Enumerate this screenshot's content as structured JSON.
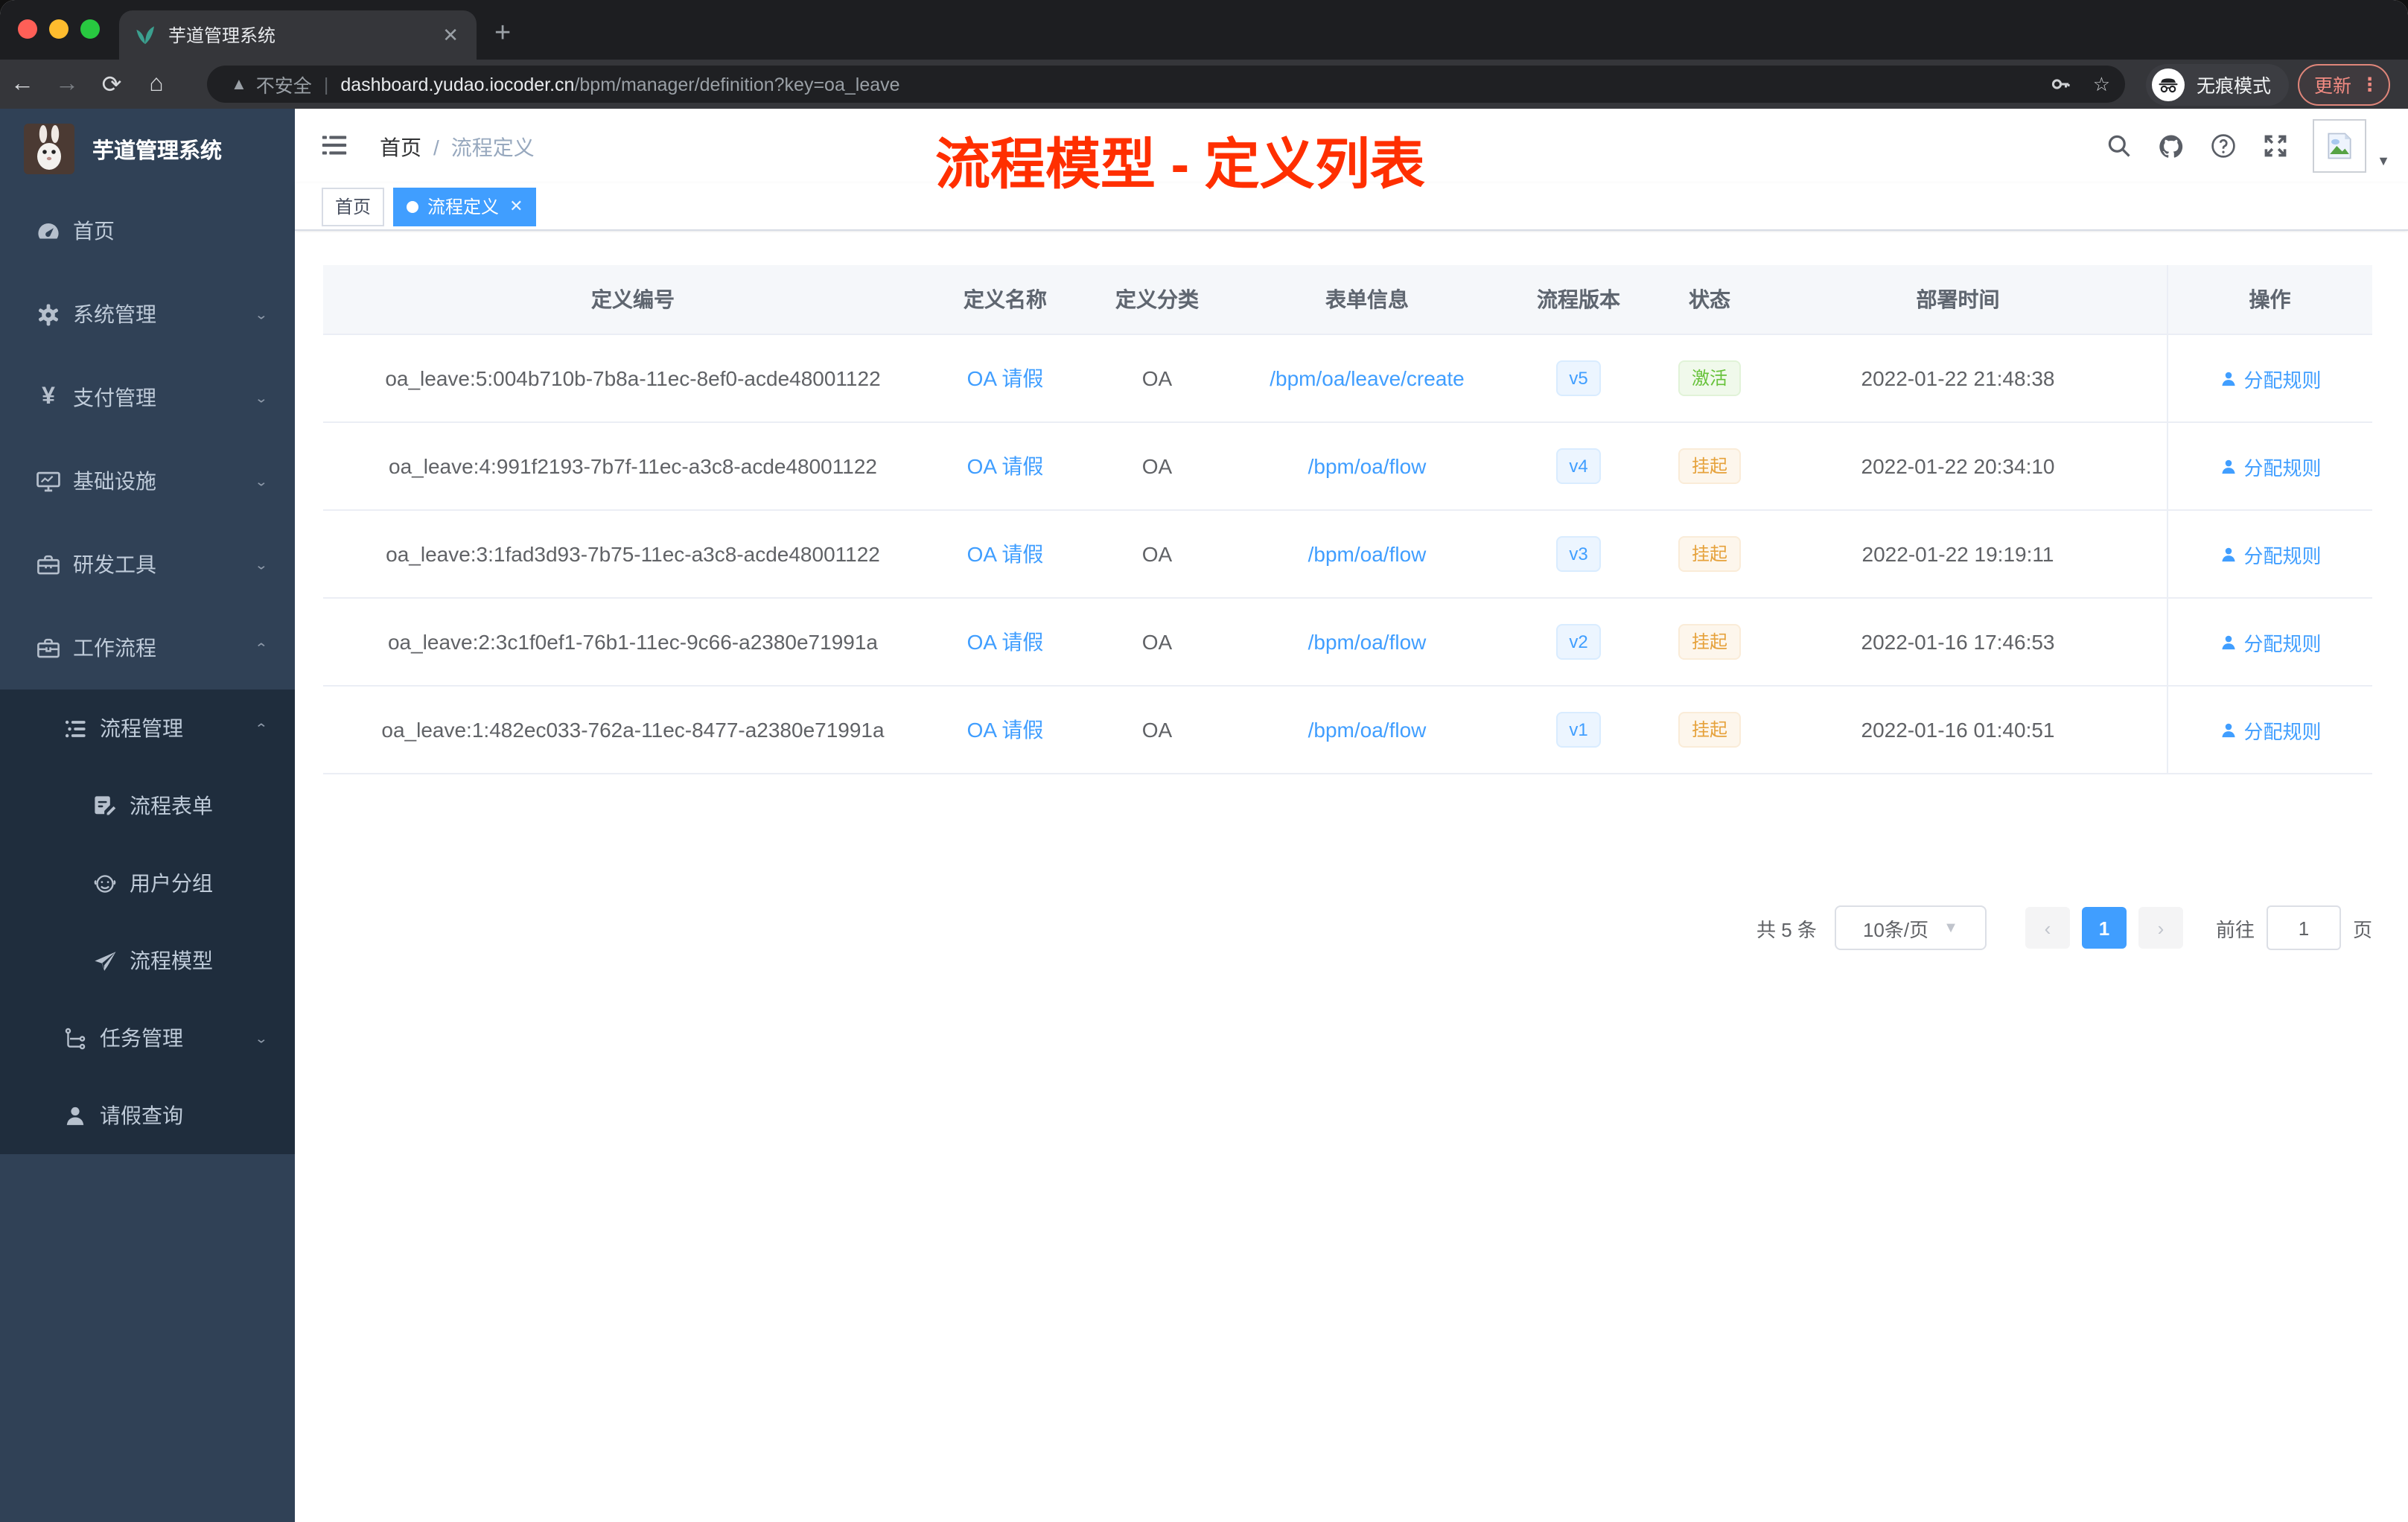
{
  "colors": {
    "accent": "#409eff",
    "active_green": "#67c23a",
    "suspended_orange": "#e6a23c",
    "annotation_red": "#ff2f00",
    "sidebar_bg": "#304156",
    "submenu_bg": "#1f2d3d"
  },
  "browser": {
    "tab_title": "芋道管理系统",
    "security_label": "不安全",
    "url_host": "dashboard.yudao.iocoder.cn",
    "url_path": "/bpm/manager/definition?key=oa_leave",
    "incognito_label": "无痕模式",
    "update_label": "更新"
  },
  "sidebar": {
    "app_title": "芋道管理系统",
    "items": [
      {
        "label": "首页",
        "icon": "dashboard-icon"
      },
      {
        "label": "系统管理",
        "icon": "gear-icon"
      },
      {
        "label": "支付管理",
        "icon": "yen-icon"
      },
      {
        "label": "基础设施",
        "icon": "monitor-icon"
      },
      {
        "label": "研发工具",
        "icon": "toolbox-icon"
      },
      {
        "label": "工作流程",
        "icon": "briefcase-icon"
      },
      {
        "label": "流程管理",
        "icon": "stream-icon"
      },
      {
        "label": "流程表单",
        "icon": "form-icon"
      },
      {
        "label": "用户分组",
        "icon": "group-icon"
      },
      {
        "label": "流程模型",
        "icon": "plane-icon"
      },
      {
        "label": "任务管理",
        "icon": "tree-icon"
      },
      {
        "label": "请假查询",
        "icon": "person-icon"
      }
    ]
  },
  "header": {
    "breadcrumb_home": "首页",
    "breadcrumb_sep": "/",
    "breadcrumb_current": "流程定义"
  },
  "tags": {
    "home": "首页",
    "active": "流程定义"
  },
  "annotation": {
    "text": "流程模型 - 定义列表"
  },
  "table": {
    "columns": [
      "定义编号",
      "定义名称",
      "定义分类",
      "表单信息",
      "流程版本",
      "状态",
      "部署时间",
      "操作"
    ],
    "action_label": "分配规则",
    "rows": [
      {
        "id": "oa_leave:5:004b710b-7b8a-11ec-8ef0-acde48001122",
        "name": "OA 请假",
        "category": "OA",
        "form": "/bpm/oa/leave/create",
        "version": "v5",
        "status": "激活",
        "deploy_time": "2022-01-22 21:48:38"
      },
      {
        "id": "oa_leave:4:991f2193-7b7f-11ec-a3c8-acde48001122",
        "name": "OA 请假",
        "category": "OA",
        "form": "/bpm/oa/flow",
        "version": "v4",
        "status": "挂起",
        "deploy_time": "2022-01-22 20:34:10"
      },
      {
        "id": "oa_leave:3:1fad3d93-7b75-11ec-a3c8-acde48001122",
        "name": "OA 请假",
        "category": "OA",
        "form": "/bpm/oa/flow",
        "version": "v3",
        "status": "挂起",
        "deploy_time": "2022-01-22 19:19:11"
      },
      {
        "id": "oa_leave:2:3c1f0ef1-76b1-11ec-9c66-a2380e71991a",
        "name": "OA 请假",
        "category": "OA",
        "form": "/bpm/oa/flow",
        "version": "v2",
        "status": "挂起",
        "deploy_time": "2022-01-16 17:46:53"
      },
      {
        "id": "oa_leave:1:482ec033-762a-11ec-8477-a2380e71991a",
        "name": "OA 请假",
        "category": "OA",
        "form": "/bpm/oa/flow",
        "version": "v1",
        "status": "挂起",
        "deploy_time": "2022-01-16 01:40:51"
      }
    ]
  },
  "pagination": {
    "total": "共 5 条",
    "page_size": "10条/页",
    "current_page": "1",
    "goto_label": "前往",
    "goto_value": "1",
    "page_unit": "页"
  }
}
